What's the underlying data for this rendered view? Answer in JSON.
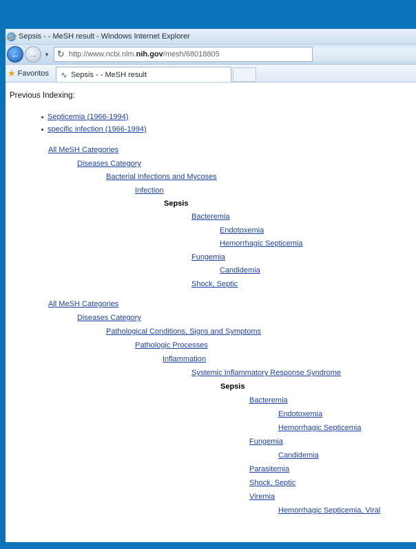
{
  "window": {
    "title": "Sepsis - - MeSH result - Windows Internet Explorer",
    "url_prefix": "http://www.ncbi.nlm.",
    "url_domain": "nih.gov",
    "url_path": "/mesh/68018805"
  },
  "favorites": {
    "label": "Favoritos"
  },
  "tab": {
    "label": "Sepsis - - MeSH result"
  },
  "content": {
    "heading": "Previous Indexing:",
    "previous_indexing": [
      "Septicemia (1966-1994)",
      "specific infection (1966-1994)"
    ],
    "tree1": [
      "All MeSH Categories",
      "Diseases Category",
      "Bacterial Infections and Mycoses",
      "Infection",
      "Sepsis",
      "Bacteremia",
      "Endotoxemia",
      "Hemorrhagic Septicemia",
      "Fungemia",
      "Candidemia",
      "Shock, Septic"
    ],
    "tree2": [
      "All MeSH Categories",
      "Diseases Category",
      "Pathological Conditions, Signs and Symptoms",
      "Pathologic Processes",
      "Inflammation",
      "Systemic Inflammatory Response Syndrome",
      "Sepsis",
      "Bacteremia",
      "Endotoxemia",
      "Hemorrhagic Septicemia",
      "Fungemia",
      "Candidemia",
      "Parasitemia",
      "Shock, Septic",
      "Viremia",
      "Hemorrhagic Septicemia, Viral"
    ]
  }
}
